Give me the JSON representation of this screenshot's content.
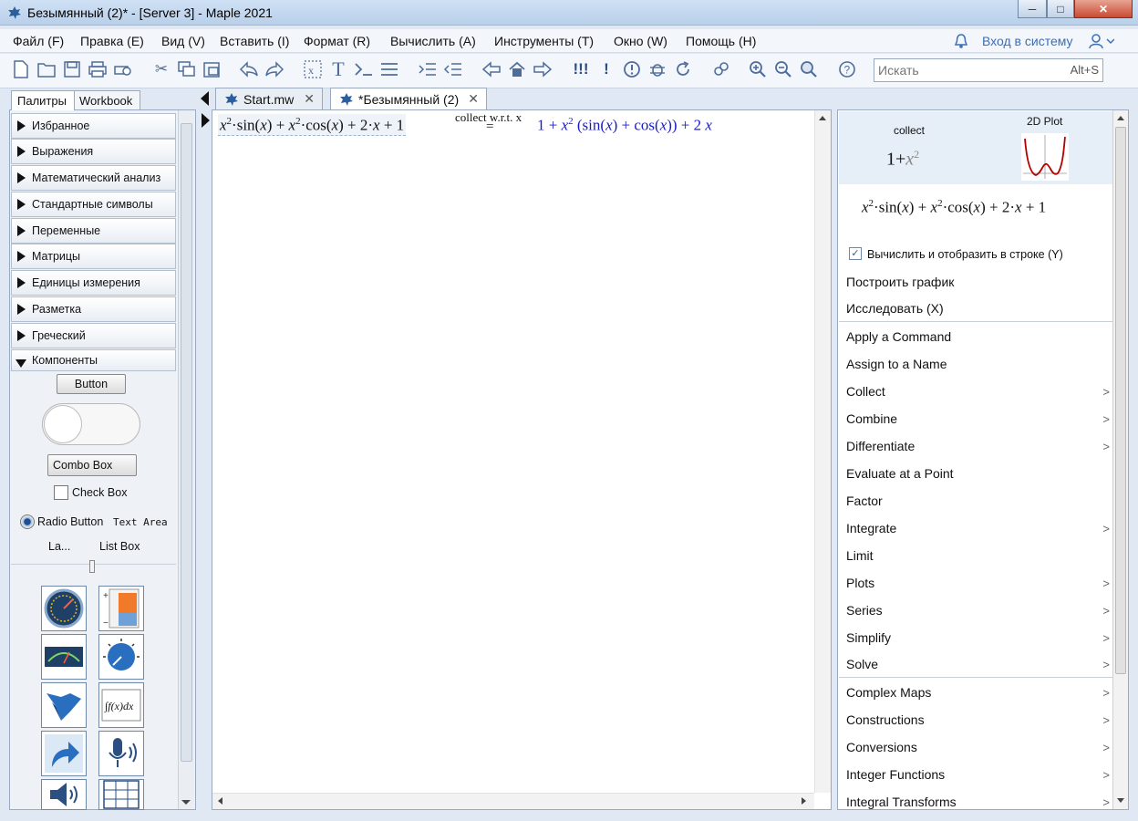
{
  "window": {
    "title": "Безымянный (2)* - [Server 3] - Maple 2021",
    "minimize": "─",
    "maximize": "□",
    "close": "✕"
  },
  "menu": {
    "items": [
      "Файл (F)",
      "Правка (E)",
      "Вид (V)",
      "Вставить (I)",
      "Формат (R)",
      "Вычислить (A)",
      "Инструменты (T)",
      "Окно (W)",
      "Помощь (H)"
    ],
    "login": "Вход в систему"
  },
  "toolbar": {
    "search_placeholder": "Искать",
    "search_shortcut": "Alt+S"
  },
  "palettes": {
    "tabs": [
      "Палитры",
      "Workbook"
    ],
    "sections": [
      "Избранное",
      "Выражения",
      "Математический анализ",
      "Стандартные символы",
      "Переменные",
      "Матрицы",
      "Единицы измерения",
      "Разметка",
      "Греческий",
      "Компоненты"
    ],
    "components": {
      "button": "Button",
      "combo_box": "Combo Box",
      "check_box": "Check Box",
      "radio_button": "Radio Button",
      "text_area": "Text Area",
      "label": "La...",
      "list_box": "List Box"
    },
    "tiles": [
      "gauge-icon",
      "volume-meter-icon",
      "meter-icon",
      "dial-icon",
      "plot-component-icon",
      "math-container-icon",
      "shortcut-arrow-icon",
      "microphone-icon",
      "speaker-icon",
      "data-table-icon"
    ]
  },
  "doc_tabs": [
    {
      "label": "Start.mw",
      "close": "✕"
    },
    {
      "label": "*Безымянный (2)",
      "close": "✕"
    }
  ],
  "document": {
    "input": {
      "t1": "x",
      "p1": "2",
      "t2": "·sin(",
      "t3": "x",
      "t4": ")",
      "t5": " + ",
      "t6": "x",
      "p2": "2",
      "t7": "·cos(",
      "t8": "x",
      "t9": ")",
      "t10": " + 2·",
      "t11": "x",
      "t12": " + 1"
    },
    "arrow_label": "collect w.r.t. x",
    "equals": "=",
    "output": {
      "o1": "1 + ",
      "o2": "x",
      "op": "2",
      "o3": " (sin(",
      "o4": "x",
      "o5": ") + cos(",
      "o6": "x",
      "o7": ")) + 2 ",
      "o8": "x"
    }
  },
  "context_panel": {
    "preview": {
      "collect_label": "collect",
      "collect_result_1": "1+",
      "collect_result_x": "x",
      "collect_result_p": "2",
      "plot_label": "2D Plot"
    },
    "expression": {
      "e1": "x",
      "ep1": "2",
      "e2": "·sin(",
      "e3": "x",
      "e4": ") + ",
      "e5": "x",
      "ep2": "2",
      "e6": "·cos(",
      "e7": "x",
      "e8": ") + 2·",
      "e9": "x",
      "e10": " + 1"
    },
    "checkbox_label": "Вычислить и отобразить в строке (Y)",
    "checkbox_checked": true,
    "plot_action": "Построить график",
    "explore_action": "Исследовать (X)",
    "items": [
      {
        "label": "Apply a Command",
        "submenu": false
      },
      {
        "label": "Assign to a Name",
        "submenu": false
      },
      {
        "label": "Collect",
        "submenu": true
      },
      {
        "label": "Combine",
        "submenu": true
      },
      {
        "label": "Differentiate",
        "submenu": true
      },
      {
        "label": "Evaluate at a Point",
        "submenu": false
      },
      {
        "label": "Factor",
        "submenu": false
      },
      {
        "label": "Integrate",
        "submenu": true
      },
      {
        "label": "Limit",
        "submenu": false
      },
      {
        "label": "Plots",
        "submenu": true
      },
      {
        "label": "Series",
        "submenu": true
      },
      {
        "label": "Simplify",
        "submenu": true
      },
      {
        "label": "Solve",
        "submenu": true
      }
    ],
    "items2": [
      {
        "label": "Complex Maps",
        "submenu": true
      },
      {
        "label": "Constructions",
        "submenu": true
      },
      {
        "label": "Conversions",
        "submenu": true
      },
      {
        "label": "Integer Functions",
        "submenu": true
      },
      {
        "label": "Integral Transforms",
        "submenu": true
      }
    ],
    "submenu_arrow": ">"
  }
}
